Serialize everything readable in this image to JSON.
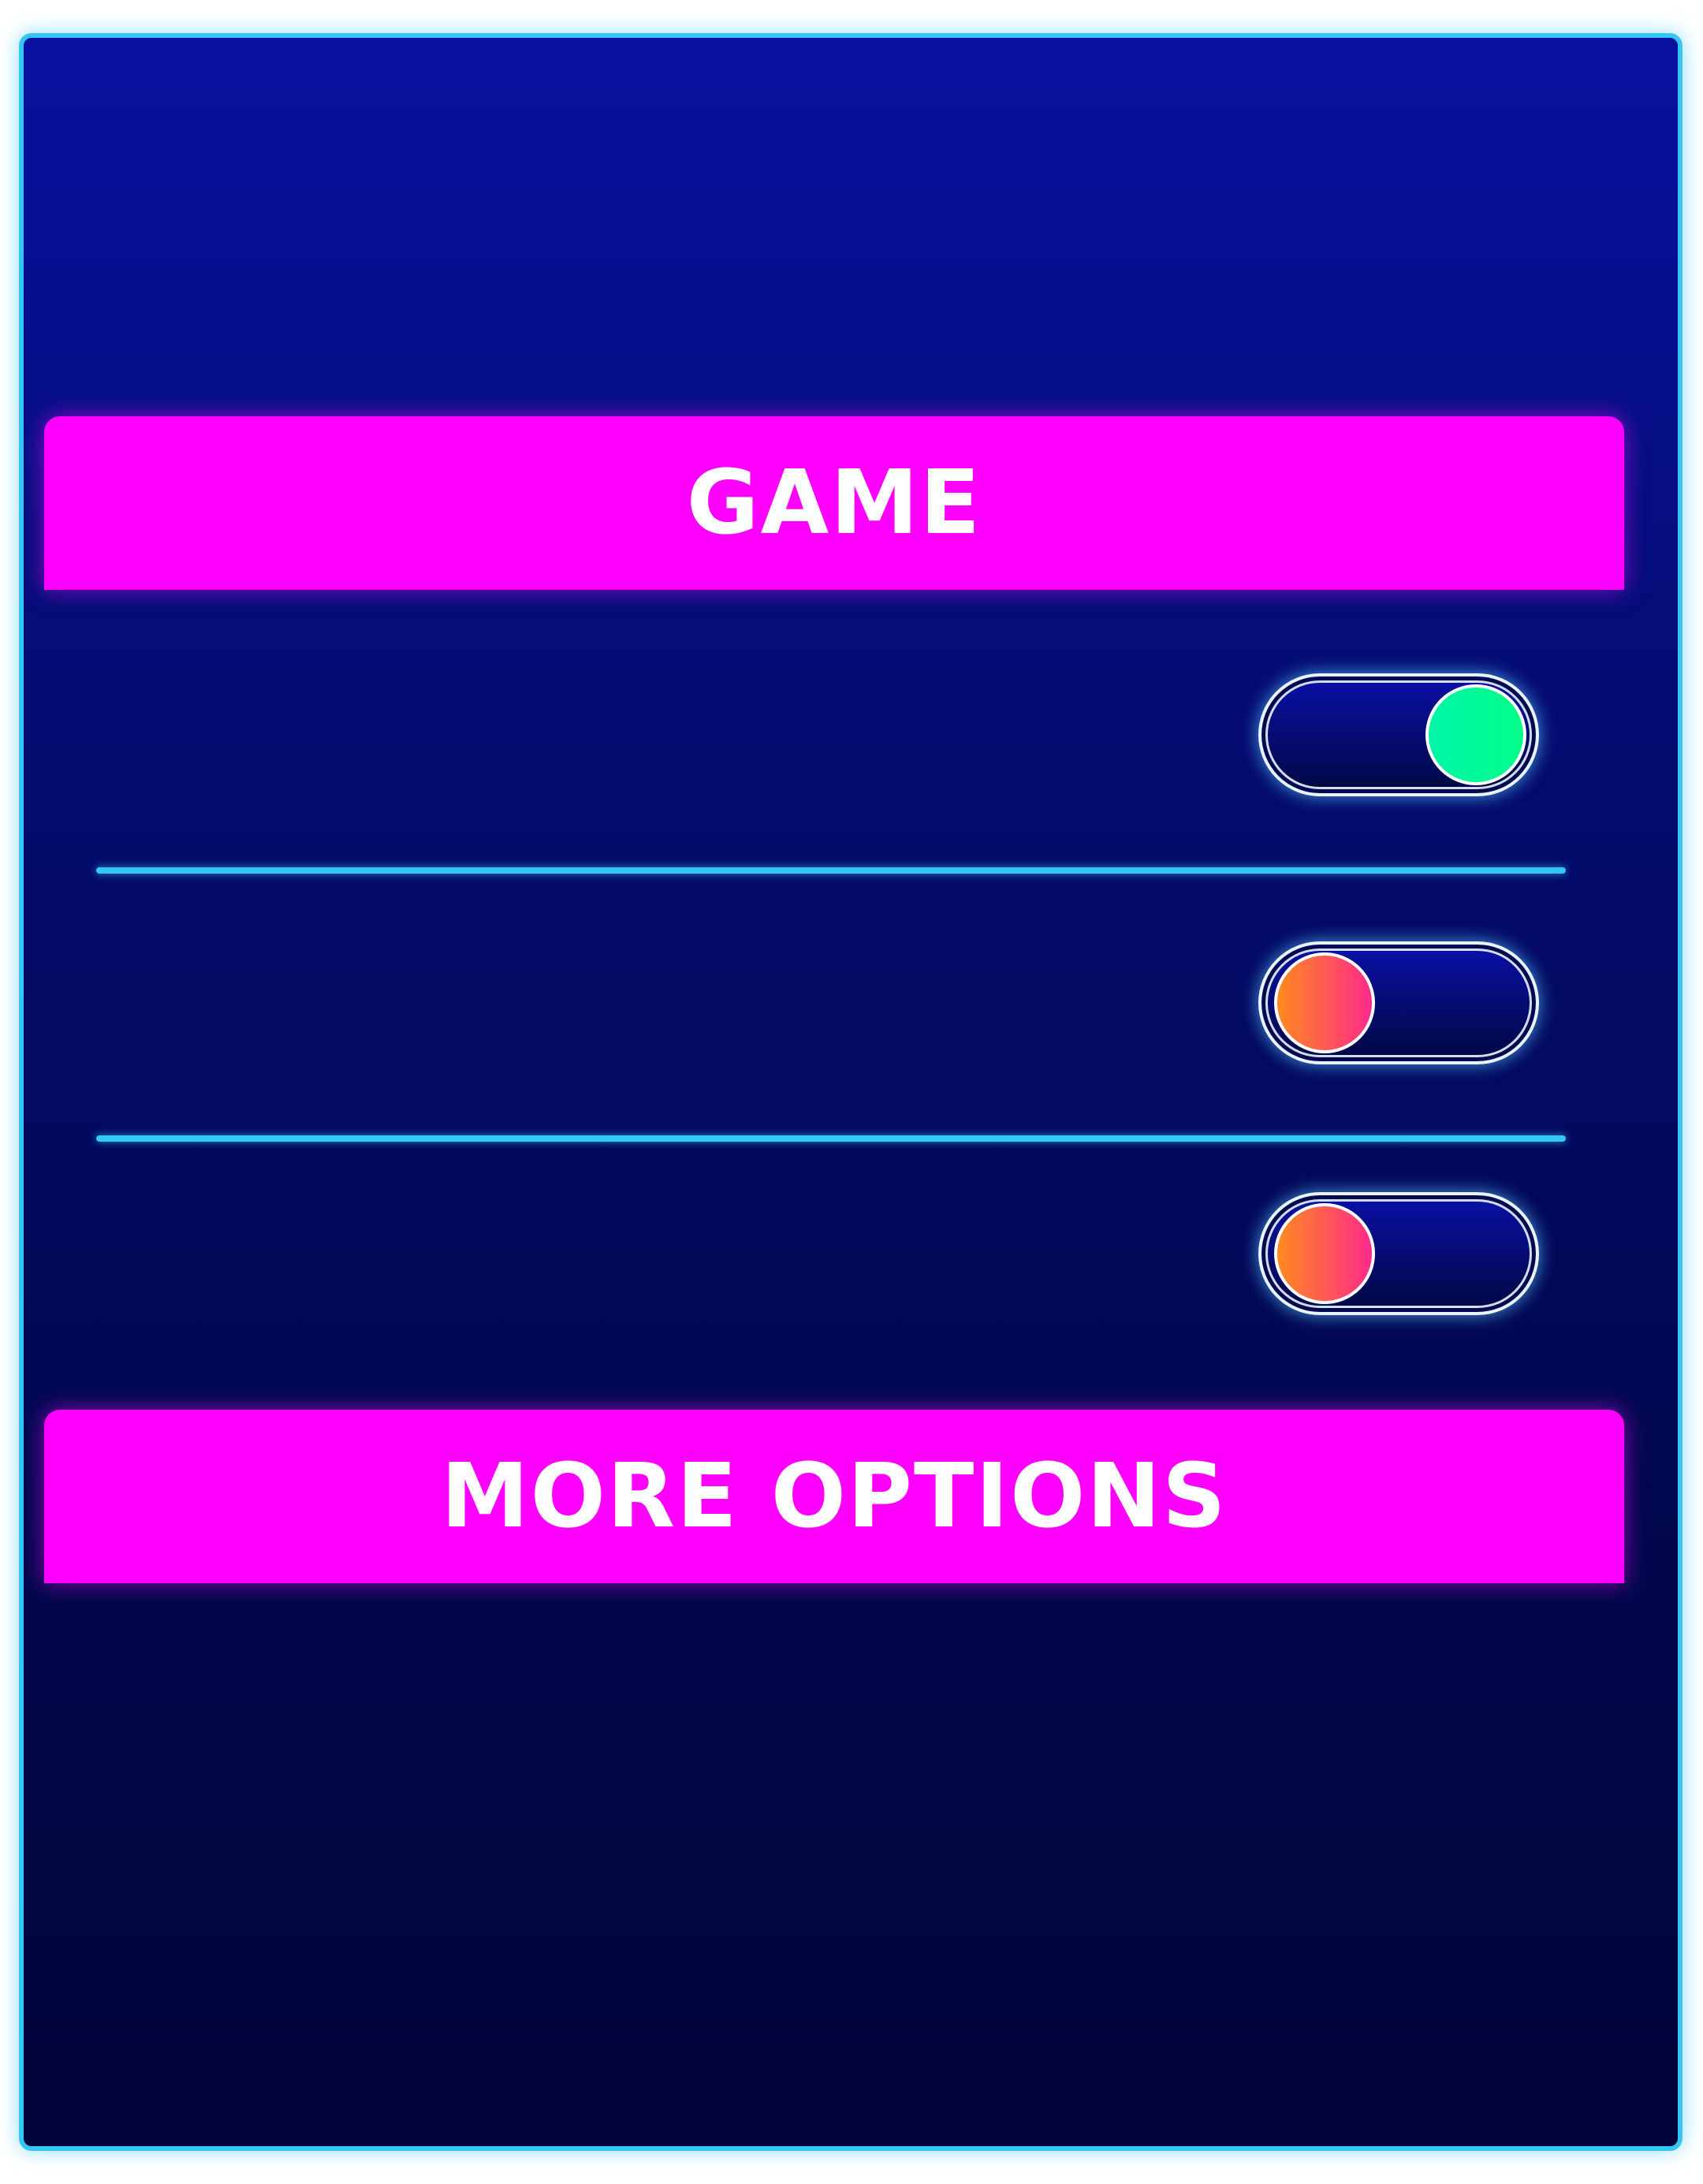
{
  "settings": {
    "game_header": "GAME",
    "more_options_header": "MORE OPTIONS",
    "toggles": [
      {
        "state": "on",
        "knob_color": "#00ff99"
      },
      {
        "state": "off",
        "knob_color": "#ff5a5a"
      },
      {
        "state": "off",
        "knob_color": "#ff5a5a"
      }
    ]
  },
  "colors": {
    "panel_border": "#34c6f4",
    "panel_background_top": "#0810a0",
    "panel_background_bottom": "#010438",
    "header_background": "#ff00ff",
    "divider": "#34c6f4",
    "toggle_on": "#00ff99",
    "toggle_off": "#ff5a5a"
  }
}
